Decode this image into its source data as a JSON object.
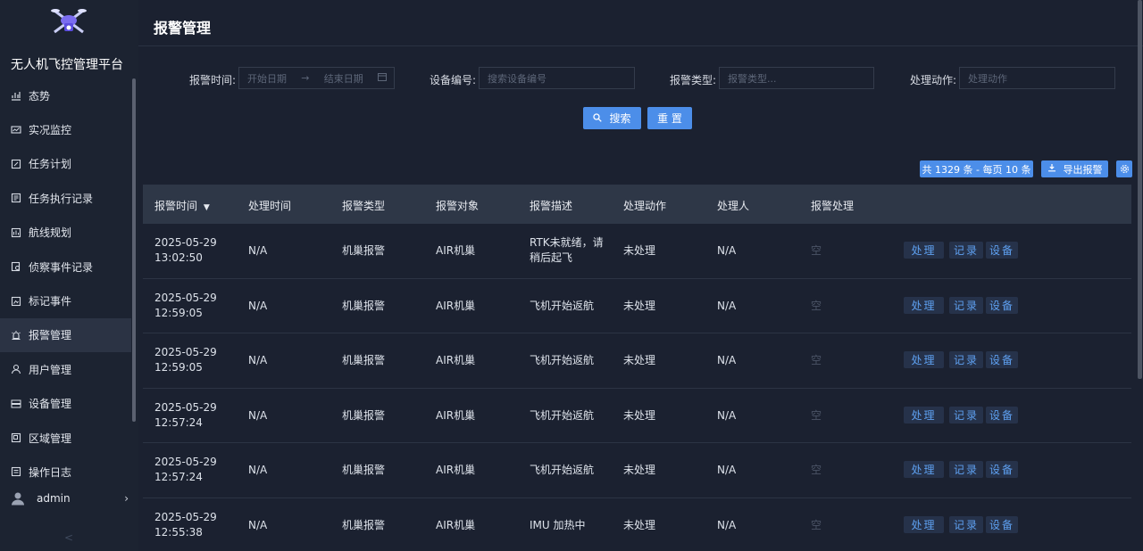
{
  "app": {
    "name": "无人机飞控管理平台",
    "page_title": "报警管理"
  },
  "sidebar": {
    "items": [
      {
        "label": "态势",
        "icon": "chart-icon",
        "active": false
      },
      {
        "label": "实况监控",
        "icon": "monitor-icon",
        "active": false
      },
      {
        "label": "任务计划",
        "icon": "task-plan-icon",
        "active": false
      },
      {
        "label": "任务执行记录",
        "icon": "record-icon",
        "active": false
      },
      {
        "label": "航线规划",
        "icon": "route-icon",
        "active": false
      },
      {
        "label": "侦察事件记录",
        "icon": "scout-icon",
        "active": false
      },
      {
        "label": "标记事件",
        "icon": "mark-icon",
        "active": false
      },
      {
        "label": "报警管理",
        "icon": "alarm-icon",
        "active": true
      },
      {
        "label": "用户管理",
        "icon": "user-icon",
        "active": false
      },
      {
        "label": "设备管理",
        "icon": "device-icon",
        "active": false
      },
      {
        "label": "区域管理",
        "icon": "area-icon",
        "active": false
      },
      {
        "label": "操作日志",
        "icon": "log-icon",
        "active": false
      }
    ],
    "user": "admin",
    "collapse": "<"
  },
  "filters": {
    "alarm_time_label": "报警时间:",
    "start_placeholder": "开始日期",
    "range_arrow": "→",
    "end_placeholder": "结束日期",
    "device_label": "设备编号:",
    "device_placeholder": "搜索设备编号",
    "type_label": "报警类型:",
    "type_placeholder": "报警类型...",
    "action_label": "处理动作:",
    "action_placeholder": "处理动作",
    "search_button": "搜索",
    "reset_button": "重 置"
  },
  "toolbar": {
    "total": "共 1329 条 - 每页 10 条",
    "export": "导出报警"
  },
  "table": {
    "columns": [
      "报警时间",
      "处理时间",
      "报警类型",
      "报警对象",
      "报警描述",
      "处理动作",
      "处理人",
      "报警处理"
    ],
    "sort_indicator": "▼",
    "actions": [
      "处理",
      "记录",
      "设备"
    ],
    "rows": [
      {
        "date": "2025-05-29",
        "time": "13:02:50",
        "handle_time": "N/A",
        "type": "机巢报警",
        "target": "AIR机巢",
        "desc": "RTK未就绪，请稍后起飞",
        "action": "未处理",
        "handler": "N/A",
        "handling": "空"
      },
      {
        "date": "2025-05-29",
        "time": "12:59:05",
        "handle_time": "N/A",
        "type": "机巢报警",
        "target": "AIR机巢",
        "desc": "飞机开始返航",
        "action": "未处理",
        "handler": "N/A",
        "handling": "空"
      },
      {
        "date": "2025-05-29",
        "time": "12:59:05",
        "handle_time": "N/A",
        "type": "机巢报警",
        "target": "AIR机巢",
        "desc": "飞机开始返航",
        "action": "未处理",
        "handler": "N/A",
        "handling": "空"
      },
      {
        "date": "2025-05-29",
        "time": "12:57:24",
        "handle_time": "N/A",
        "type": "机巢报警",
        "target": "AIR机巢",
        "desc": "飞机开始返航",
        "action": "未处理",
        "handler": "N/A",
        "handling": "空"
      },
      {
        "date": "2025-05-29",
        "time": "12:57:24",
        "handle_time": "N/A",
        "type": "机巢报警",
        "target": "AIR机巢",
        "desc": "飞机开始返航",
        "action": "未处理",
        "handler": "N/A",
        "handling": "空"
      },
      {
        "date": "2025-05-29",
        "time": "12:55:38",
        "handle_time": "N/A",
        "type": "机巢报警",
        "target": "AIR机巢",
        "desc": "IMU 加热中",
        "action": "未处理",
        "handler": "N/A",
        "handling": "空"
      }
    ]
  },
  "colors": {
    "accent": "#4c8ee9",
    "background": "#1b2130",
    "sidebar": "#1c2331",
    "table_header": "#2e3747",
    "action_text": "#5ea0f0"
  }
}
